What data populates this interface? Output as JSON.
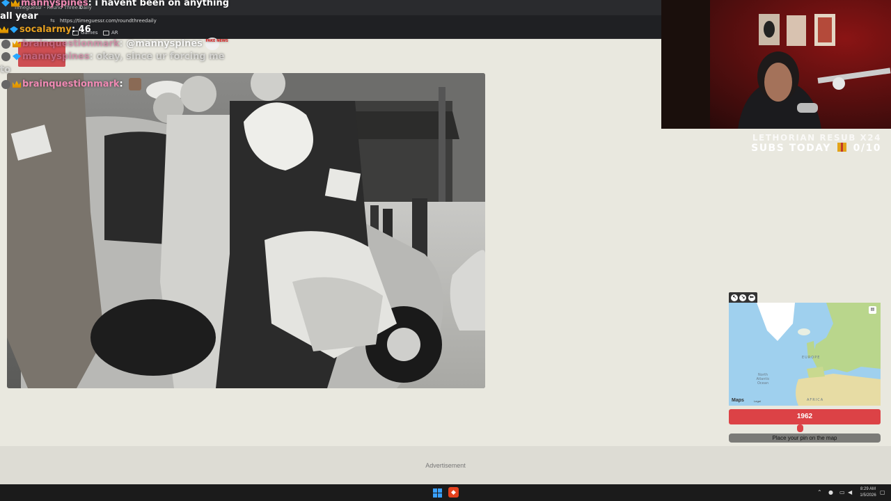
{
  "browser": {
    "tab_title": "Timeguessr - Round Three Daily",
    "tab_close": "×",
    "url": "https://timeguessr.com/roundthreedaily",
    "bookmarks": [
      {
        "label": "Games"
      },
      {
        "label": "AR"
      }
    ]
  },
  "chat": [
    {
      "user": "mannyspines",
      "message": "i havent been on anything"
    },
    {
      "user": "",
      "message": "all year"
    },
    {
      "user": "socalarmy",
      "message": "46"
    },
    {
      "user": "brainquestionmark",
      "message": "@mannyspines"
    },
    {
      "user": "mannyspines",
      "message": "okay, since ur forcing me"
    },
    {
      "user": "",
      "message": "to"
    },
    {
      "user": "brainquestionmark",
      "message": ""
    }
  ],
  "chat_separator": ": ",
  "fake_news_badge": "FAKE NEWS",
  "overlay": {
    "subs_goal_line1": "LETHORIAN RESUB X24",
    "subs_goal_prefix": "SUBS TODAY",
    "subs_goal_count": "0/10"
  },
  "map": {
    "labels": {
      "europe": "EUROPE",
      "africa": "AFRICA",
      "ocean": "North Atlantic Ocean"
    },
    "brand": "Maps",
    "legal": "Legal",
    "controls": [
      "expand-icon",
      "shrink-icon",
      "pin-icon"
    ]
  },
  "game": {
    "year": "1962",
    "year_slider_fraction": 0.47,
    "pin_prompt": "Place your pin on the map"
  },
  "advertisement_label": "Advertisement",
  "taskbar": {
    "time": "8:29 AM",
    "date": "1/5/2026"
  },
  "colors": {
    "page_bg": "#e9e8df",
    "accent_red": "#dc4246",
    "chat_user": "#f08ab4",
    "map_water": "#9fd0ee",
    "map_land": "#b9d68c"
  }
}
